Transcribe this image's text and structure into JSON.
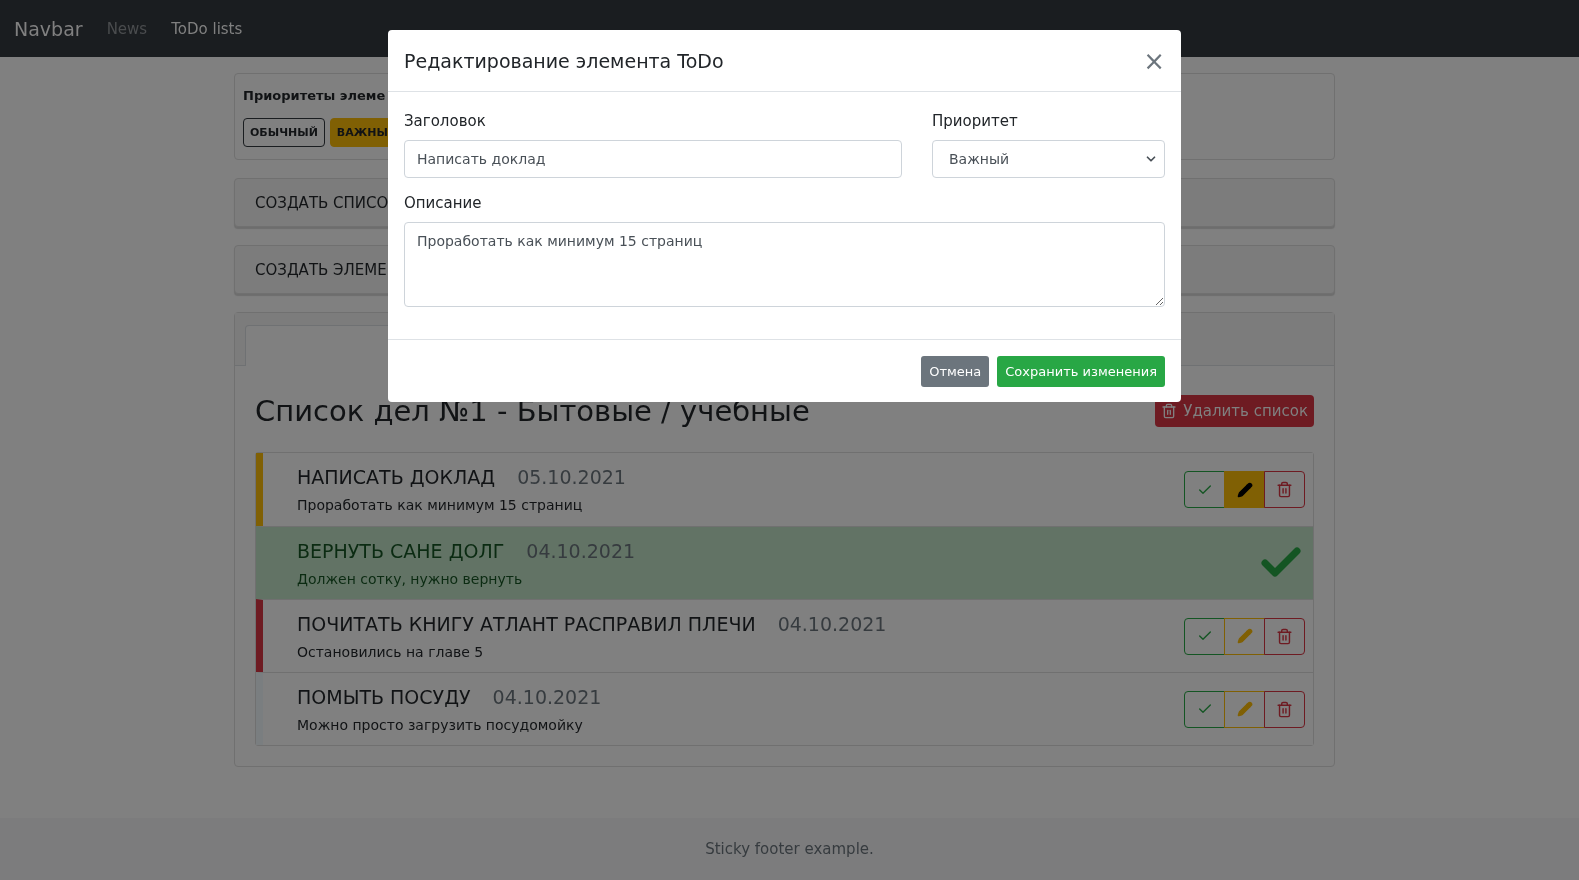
{
  "navbar": {
    "brand": "Navbar",
    "links": [
      {
        "label": "News",
        "selected": false
      },
      {
        "label": "ToDo lists",
        "selected": true
      }
    ]
  },
  "priorities": {
    "title": "Приоритеты элеме",
    "badges": [
      {
        "label": "ОБЫЧНЫЙ",
        "color": "#1a1d20",
        "filled": false
      },
      {
        "label": "ВАЖНЫ",
        "color": "#806004",
        "filled": true
      }
    ]
  },
  "actions": [
    "СОЗДАТЬ СПИСО",
    "СОЗДАТЬ ЭЛЕМЕ"
  ],
  "list": {
    "heading": "Список дел №1 - Бытовые / учебные",
    "delete_button": "Удалить список",
    "items": [
      {
        "title": "НАПИСАТЬ ДОКЛАД",
        "date": "05.10.2021",
        "description": "Проработать как минимум 15 страниц",
        "color": "#806004",
        "done": false,
        "editing": true
      },
      {
        "title": "ВЕРНУТЬ САНЕ ДОЛГ",
        "date": "04.10.2021",
        "description": "Должен сотку, нужно вернуть",
        "color": "#627365",
        "done": true
      },
      {
        "title": "ПОЧИТАТЬ КНИГУ АТЛАНТ РАСПРАВИЛ ПЛЕЧИ",
        "date": "04.10.2021",
        "description": "Остановились на главе 5",
        "color": "#6e1b22",
        "done": false,
        "editing": false
      },
      {
        "title": "ПОМЫТЬ ПОСУДУ",
        "date": "04.10.2021",
        "description": "Можно просто загрузить посудомойку",
        "color": "#7a7e80",
        "done": false,
        "editing": false
      }
    ]
  },
  "modal": {
    "title": "Редактирование элемента ToDo",
    "close": "×",
    "title_label": "Заголовок",
    "title_value": "Написать доклад",
    "priority_label": "Приоритет",
    "priority_value": "Важный",
    "description_label": "Описание",
    "description_value": "Проработать как минимум 15 страниц",
    "cancel": "Отмена",
    "save": "Сохранить изменения"
  },
  "footer": "Sticky footer example."
}
